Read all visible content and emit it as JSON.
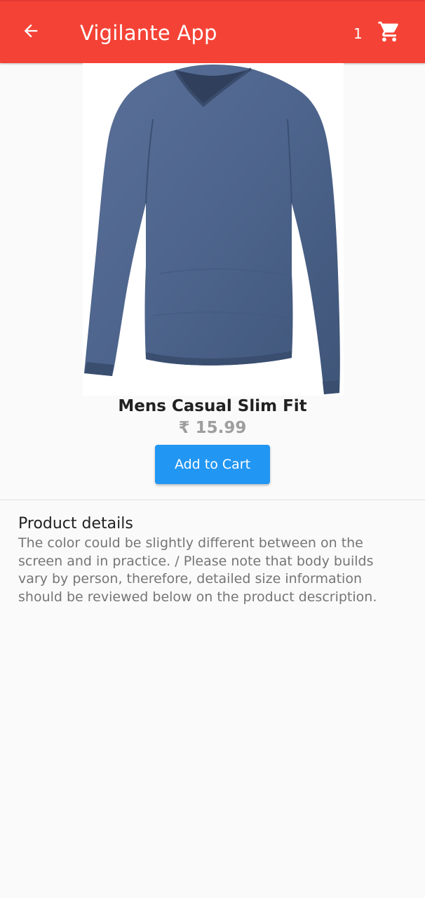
{
  "appbar": {
    "title": "Vigilante App",
    "back_icon": "arrow-back-icon",
    "cart_count": "1",
    "cart_icon": "shopping-cart-icon",
    "background_color": "#f44336"
  },
  "product": {
    "image_icon": "long-sleeve-tshirt-image",
    "title": "Mens Casual Slim Fit",
    "price": "₹ 15.99",
    "add_to_cart_label": "Add to Cart",
    "button_color": "#2196f3"
  },
  "details": {
    "heading": "Product details",
    "description": "The color could be slightly different between on the screen and in practice. / Please note that body builds vary by person, therefore, detailed size information should be reviewed below on the product description."
  }
}
